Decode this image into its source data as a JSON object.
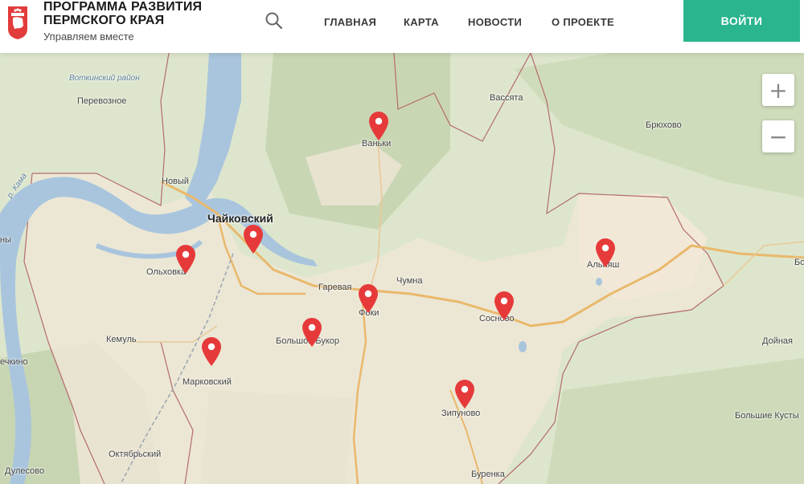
{
  "header": {
    "title_line1": "ПРОГРАММА РАЗВИТИЯ",
    "title_line2": "ПЕРМСКОГО КРАЯ",
    "subtitle": "Управляем вместе",
    "nav": [
      "ГЛАВНАЯ",
      "КАРТА",
      "НОВОСТИ",
      "О ПРОЕКТЕ"
    ],
    "login_label": "ВОЙТИ",
    "accent_color": "#2ab58f"
  },
  "map": {
    "zoom_in": "+",
    "zoom_out": "−",
    "pin_color": "#e63a3a",
    "places": [
      "Воткинский район",
      "Перевозное",
      "Вассята",
      "Брюхово",
      "Ваньки",
      "Новый",
      "р. Кама",
      "Чайковский",
      "Ольховка",
      "Гаревая",
      "Чумна",
      "Фоки",
      "Сосново",
      "Альняш",
      "Кемуль",
      "Большой Букор",
      "Марковский",
      "Зипуново",
      "Октябрьский",
      "Дулесово",
      "Буренка",
      "Дойная",
      "Большие Кусты",
      "ечкино",
      "ны",
      "Бо"
    ]
  }
}
